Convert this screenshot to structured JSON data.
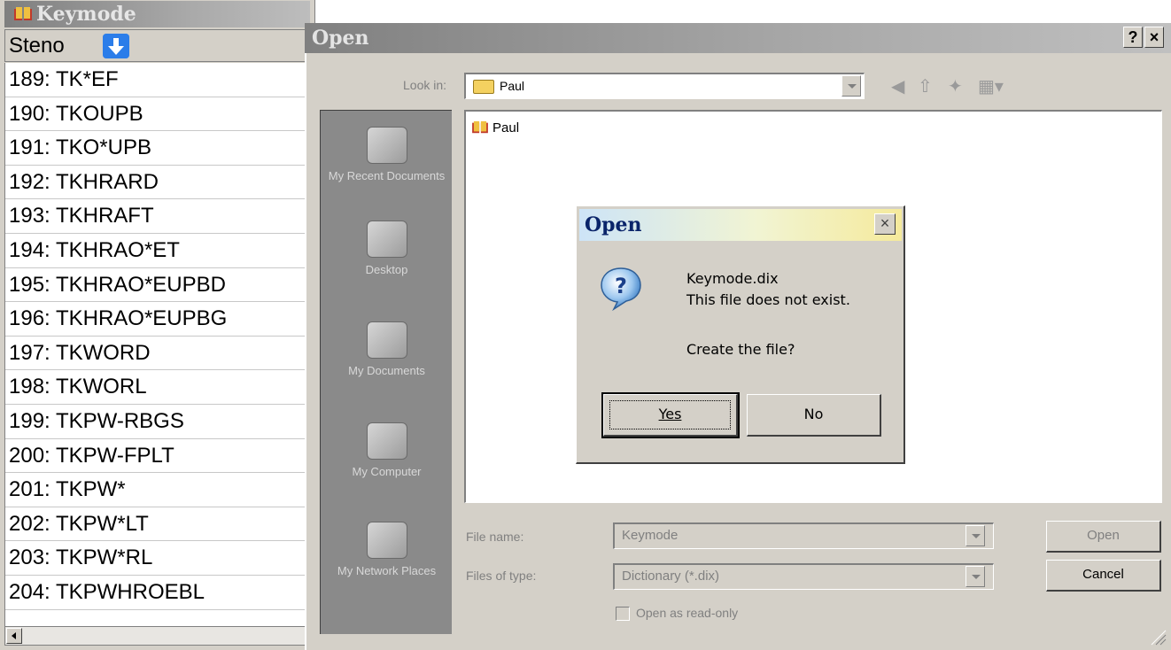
{
  "keymode": {
    "title": "Keymode",
    "column_header": "Steno",
    "rows": [
      "189: TK*EF",
      "190: TKOUPB",
      "191: TKO*UPB",
      "192: TKHRARD",
      "193: TKHRAFT",
      "194: TKHRAO*ET",
      "195: TKHRAO*EUPBD",
      "196: TKHRAO*EUPBG",
      "197: TKWORD",
      "198: TKWORL",
      "199: TKPW-RBGS",
      "200: TKPW-FPLT",
      "201: TKPW*",
      "202: TKPW*LT",
      "203: TKPW*RL",
      "204: TKPWHROEBL"
    ]
  },
  "open_dialog": {
    "title": "Open",
    "help_label": "?",
    "close_label": "×",
    "look_in_label": "Look in:",
    "look_in_value": "Paul",
    "places": [
      {
        "label": "My Recent Documents"
      },
      {
        "label": "Desktop"
      },
      {
        "label": "My Documents"
      },
      {
        "label": "My Computer"
      },
      {
        "label": "My Network Places"
      }
    ],
    "file_item": "Paul",
    "file_name_label": "File name:",
    "file_name_value": "Keymode",
    "file_type_label": "Files of type:",
    "file_type_value": "Dictionary (*.dix)",
    "read_only_label": "Open as read-only",
    "open_button": "Open",
    "cancel_button": "Cancel"
  },
  "confirm": {
    "title": "Open",
    "close_label": "×",
    "file_line": "Keymode.dix",
    "message": "This file does not exist.",
    "question": "Create the file?",
    "yes_label": "Yes",
    "no_label": "No"
  },
  "colors": {
    "accent_arrow": "#2b7de9",
    "modal_title_text": "#0a246a"
  }
}
